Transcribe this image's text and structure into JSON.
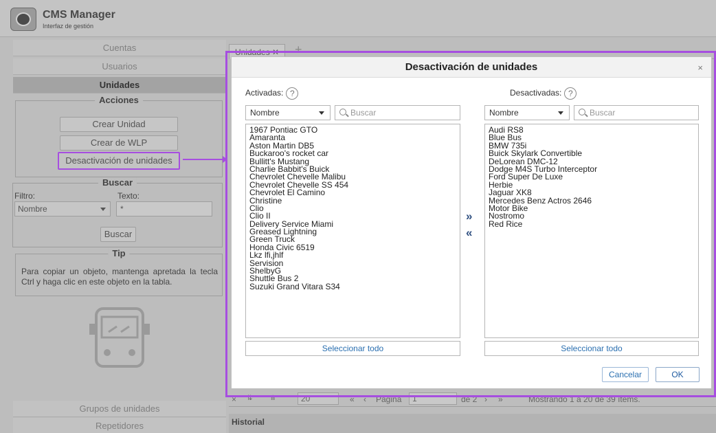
{
  "app": {
    "title": "CMS Manager",
    "subtitle": "Interfaz de gestión",
    "logo_icon": "logo-icon"
  },
  "sidebar": {
    "nav": [
      "Cuentas",
      "Usuarios",
      "Unidades"
    ],
    "actions": {
      "legend": "Acciones",
      "buttons": [
        "Crear Unidad",
        "Crear de WLP",
        "Desactivación de unidades"
      ]
    },
    "search": {
      "legend": "Buscar",
      "filter_label": "Filtro:",
      "text_label": "Texto:",
      "filter_value": "Nombre",
      "text_value": "*",
      "button": "Buscar"
    },
    "tip": {
      "legend": "Tip",
      "text": "Para copiar un objeto, mantenga apretada la tecla Ctrl y haga clic en este objeto en la tabla."
    },
    "bottom_nav": [
      "Grupos de unidades",
      "Repetidores"
    ],
    "illustration_icon": "bus-icon"
  },
  "background_panel": {
    "tab_label": "Unidades ✕",
    "add_tab": "+",
    "pager": {
      "close": "×",
      "page_size": "20",
      "first": "«",
      "prev": "‹",
      "page_label": "Página",
      "page_value": "1",
      "of_label": "de 2",
      "next": "›",
      "last": "»",
      "showing": "Mostrando 1 a 20 de 39 ítems."
    },
    "historial": "Historial"
  },
  "dialog": {
    "title": "Desactivación de unidades",
    "close": "×",
    "left": {
      "label": "Activadas:",
      "filter_value": "Nombre",
      "search_placeholder": "Buscar",
      "select_all": "Seleccionar todo",
      "items": [
        "1967 Pontiac GTO",
        "Amaranta",
        "Aston Martin DB5",
        "Buckaroo's rocket car",
        "Bullitt's Mustang",
        "Charlie Babbit's Buick",
        "Chevrolet Chevelle Malibu",
        "Chevrolet Chevelle SS 454",
        "Chevrolet El Camino",
        "Christine",
        "Clio",
        "Clio II",
        "Delivery Service Miami",
        "Greased Lightning",
        "Green Truck",
        "Honda Civic 6519",
        "Lkz lfi,jhlf",
        "Servision",
        "ShelbyG",
        "Shuttle Bus 2",
        "Suzuki Grand Vitara S34"
      ]
    },
    "right": {
      "label": "Desactivadas:",
      "filter_value": "Nombre",
      "search_placeholder": "Buscar",
      "select_all": "Seleccionar todo",
      "items": [
        "Audi RS8",
        "Blue Bus",
        "BMW 735i",
        "Buick Skylark Convertible",
        "DeLorean DMC-12",
        "Dodge M4S Turbo Interceptor",
        "Ford Super De Luxe",
        "Herbie",
        "Jaguar XK8",
        "Mercedes Benz Actros 2646",
        "Motor Bike",
        "Nostromo",
        "Red Rice"
      ]
    },
    "move_right": "»",
    "move_left": "«",
    "help": "?",
    "cancel": "Cancelar",
    "ok": "OK"
  },
  "colors": {
    "highlight": "#a64ee0",
    "link": "#2a6fb0"
  }
}
